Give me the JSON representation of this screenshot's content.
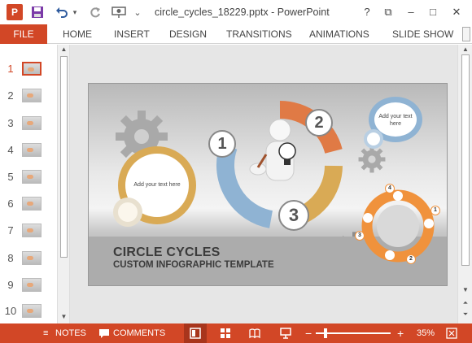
{
  "window": {
    "title": "circle_cycles_18229.pptx - PowerPoint",
    "help_glyph": "?",
    "restore_glyph": "⧉",
    "minimize_glyph": "–",
    "maximize_glyph": "□",
    "close_glyph": "✕"
  },
  "quick_access": {
    "app_icon_letter": "P",
    "save_icon": "save-icon",
    "undo_icon": "undo-icon",
    "redo_icon": "redo-icon",
    "start_icon": "present-from-start-icon",
    "customize_glyph": "⌄"
  },
  "ribbon": {
    "file": "FILE",
    "tabs": [
      "HOME",
      "INSERT",
      "DESIGN",
      "TRANSITIONS",
      "ANIMATIONS",
      "SLIDE SHOW"
    ]
  },
  "thumbnails": {
    "numbers": [
      "1",
      "2",
      "3",
      "4",
      "5",
      "6",
      "7",
      "8",
      "9",
      "10"
    ],
    "active_index": 0
  },
  "slide": {
    "title": "CIRCLE CYCLES",
    "subtitle": "CUSTOM INFOGRAPHIC TEMPLATE",
    "left_bubble_text": "Add your text here",
    "right_bubble_text": "Add your text here",
    "cycle_numbers": [
      "1",
      "2",
      "3"
    ],
    "small_cycle_numbers": [
      "1",
      "2",
      "3",
      "4"
    ]
  },
  "status_bar": {
    "notes": "NOTES",
    "comments": "COMMENTS",
    "zoom_minus": "−",
    "zoom_plus": "+",
    "zoom_level": "35%"
  },
  "colors": {
    "accent": "#d24726",
    "orange": "#e07a45",
    "blue": "#8fb3d3",
    "gold": "#d9aa55",
    "bright_orange": "#f0923c"
  }
}
